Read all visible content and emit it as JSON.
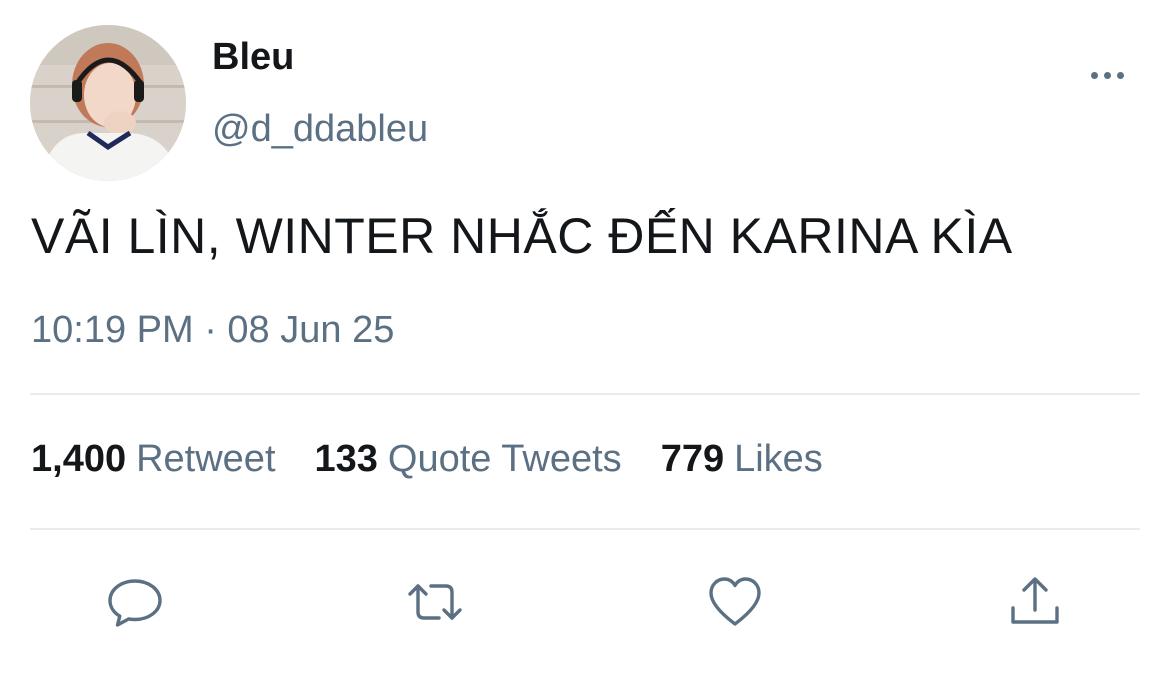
{
  "author": {
    "display_name": "Bleu",
    "handle": "@d_ddableu"
  },
  "tweet": {
    "text": "VÃI LÌN, WINTER NHẮC ĐẾN KARINA KÌA",
    "timestamp": "10:19 PM · 08 Jun 25"
  },
  "stats": {
    "retweets": {
      "count": "1,400",
      "label": "Retweet"
    },
    "quotes": {
      "count": "133",
      "label": "Quote Tweets"
    },
    "likes": {
      "count": "779",
      "label": "Likes"
    }
  },
  "actions": [
    {
      "name": "reply",
      "icon": "reply-icon"
    },
    {
      "name": "retweet",
      "icon": "retweet-icon"
    },
    {
      "name": "like",
      "icon": "heart-icon"
    },
    {
      "name": "share",
      "icon": "share-icon"
    }
  ],
  "colors": {
    "text": "#14171a",
    "secondary": "#5b7083",
    "divider": "#e6ecf0",
    "icon": "#5b7083"
  }
}
